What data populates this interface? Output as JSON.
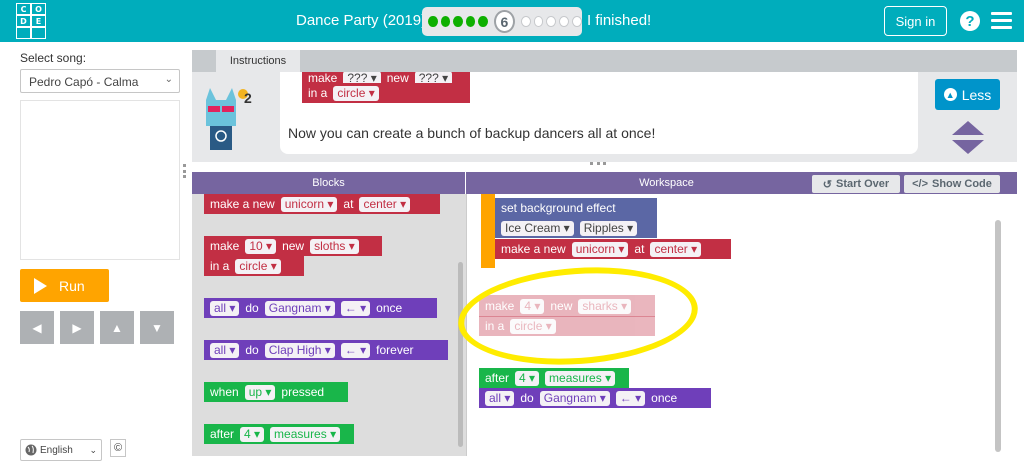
{
  "header": {
    "logo_letters": [
      "C",
      "O",
      "D",
      "E"
    ],
    "title": "Dance Party (2019)",
    "progress": {
      "completed": 5,
      "current": "6",
      "remaining": 5
    },
    "finished_label": "I finished!",
    "signin_label": "Sign in",
    "help_icon": "?",
    "colors": {
      "bar": "#00adbc",
      "done": "#0eb000"
    }
  },
  "left_panel": {
    "song_label": "Select song:",
    "song_value": "Pedro Capó - Calma",
    "run_label": "Run",
    "arrows": [
      "◀",
      "▶",
      "▲",
      "▼"
    ],
    "language": "English",
    "copyright": "©"
  },
  "instructions": {
    "tab_label": "Instructions",
    "text": "Now you can create a bunch of backup dancers all at once!",
    "less_label": "Less",
    "hint_count": "2",
    "preview_block": {
      "make": "make",
      "count": "???",
      "new": "new",
      "kind": "???",
      "in_a": "in a",
      "shape": "circle"
    }
  },
  "blocks_panel": {
    "title": "Blocks",
    "items": [
      {
        "parts": [
          "make a new",
          "unicorn",
          "at",
          "center"
        ]
      },
      {
        "parts": [
          "make",
          "10",
          "new",
          "sloths",
          "in a",
          "circle"
        ]
      },
      {
        "parts": [
          "all",
          "do",
          "Gangnam",
          "←",
          "once"
        ]
      },
      {
        "parts": [
          "all",
          "do",
          "Clap High",
          "←",
          "forever"
        ]
      },
      {
        "parts": [
          "when",
          "up",
          "pressed"
        ]
      },
      {
        "parts": [
          "after",
          "4",
          "measures"
        ]
      }
    ]
  },
  "workspace": {
    "title": "Workspace",
    "start_over_label": "Start Over",
    "show_code_label": "Show Code",
    "bg_effect": {
      "label": "set background effect",
      "palette": "Ice Cream",
      "effect": "Ripples"
    },
    "make_new": {
      "parts": [
        "make a new",
        "unicorn",
        "at",
        "center"
      ]
    },
    "ghost_block": {
      "parts": [
        "make",
        "4",
        "new",
        "sharks",
        "in a",
        "circle"
      ]
    },
    "after_block": {
      "parts": [
        "after",
        "4",
        "measures"
      ]
    },
    "all_do": {
      "parts": [
        "all",
        "do",
        "Gangnam",
        "←",
        "once"
      ]
    }
  }
}
